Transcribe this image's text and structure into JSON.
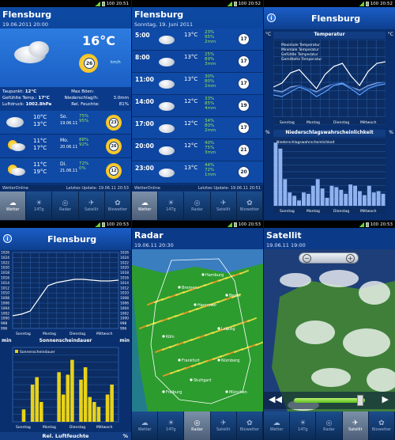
{
  "status_times": [
    "20:51",
    "20:52",
    "20:52",
    "20:53",
    "20:53",
    "20:53"
  ],
  "battery": "100",
  "p1": {
    "title": "Flensburg",
    "date": "19.06.2011 20:00",
    "temp": "16°C",
    "wind_speed": "26",
    "wind_unit": "km/h",
    "details": [
      {
        "label": "Taupunkt:",
        "value": "12°C",
        "label2": "Max Böen:",
        "value2": ""
      },
      {
        "label": "Gefühlte Temp.:",
        "value": "17°C",
        "label2": "Niederschlag/h:",
        "value2": "3.0mm"
      },
      {
        "label": "Luftdruck:",
        "value": "1002.8hPa",
        "label2": "Rel. Feuchte:",
        "value2": "81%"
      }
    ],
    "days": [
      {
        "hi": "10°C",
        "lo": "13°C",
        "day": "So.",
        "date": "19.06.11",
        "p1": "75%",
        "p2": "95%",
        "p3": "",
        "wind": "23"
      },
      {
        "hi": "11°C",
        "lo": "17°C",
        "day": "Mo.",
        "date": "20.06.11",
        "p1": "88%",
        "p2": "92%",
        "p3": "",
        "wind": "26"
      },
      {
        "hi": "11°C",
        "lo": "19°C",
        "day": "Di.",
        "date": "21.06.11",
        "p1": "72%",
        "p2": "0%",
        "p3": "",
        "wind": "12"
      }
    ],
    "footer_left": "WetterOnline",
    "footer_right": "Letztes Update: 19.06.11 20:53",
    "tabs": [
      "Wetter",
      "14Tg",
      "Radar",
      "Satellit",
      "Biowetter"
    ]
  },
  "p2": {
    "title": "Flensburg",
    "date": "Sonntag, 19. Juni 2011",
    "hours": [
      {
        "time": "5:00",
        "temp": "13°C",
        "g1": "23%",
        "g2": "95%",
        "g3": "2mm",
        "wind": "17"
      },
      {
        "time": "8:00",
        "temp": "13°C",
        "g1": "25%",
        "g2": "89%",
        "g3": "3mm",
        "wind": "17"
      },
      {
        "time": "11:00",
        "temp": "13°C",
        "g1": "30%",
        "g2": "80%",
        "g3": "2mm",
        "wind": "17"
      },
      {
        "time": "14:00",
        "temp": "12°C",
        "g1": "33%",
        "g2": "85%",
        "g3": "4mm",
        "wind": "19"
      },
      {
        "time": "17:00",
        "temp": "12°C",
        "g1": "34%",
        "g2": "80%",
        "g3": "2mm",
        "wind": "17"
      },
      {
        "time": "20:00",
        "temp": "12°C",
        "g1": "40%",
        "g2": "75%",
        "g3": "3mm",
        "wind": "21"
      },
      {
        "time": "23:00",
        "temp": "13°C",
        "g1": "44%",
        "g2": "72%",
        "g3": "1mm",
        "wind": "20"
      }
    ],
    "footer_left": "WetterOnline",
    "footer_right": "Letztes Update: 19.06.11 20:51",
    "tabs": [
      "Wetter",
      "14Tg",
      "Radar",
      "Satellit",
      "Biowetter"
    ]
  },
  "p3": {
    "title": "Flensburg",
    "chart1_title": "Temperatur",
    "chart1_unit": "°C",
    "chart1_legend": [
      "Maximale Temperatur",
      "Minimale Temperatur",
      "Gefühlte Temperatur",
      "Gemittelte Temperatur"
    ],
    "chart2_title": "Niederschlagswahrscheinlichkeit",
    "chart2_unit": "%",
    "chart2_legend": [
      "Niederschlagswahrscheinlichkeit"
    ],
    "days": [
      "Sonntag",
      "Montag",
      "Dienstag",
      "Mittwoch"
    ],
    "tabs": [
      "Wetter",
      "14Tg",
      "Radar",
      "Satellit",
      "Biowetter"
    ]
  },
  "p4": {
    "title": "Flensburg",
    "yaxis": [
      "1026",
      "1024",
      "1022",
      "1020",
      "1018",
      "1016",
      "1014",
      "1012",
      "1010",
      "1008",
      "1006",
      "1004",
      "1002",
      "1000",
      "998",
      "996"
    ],
    "days": [
      "Sonntag",
      "Montag",
      "Dienstag",
      "Mittwoch"
    ],
    "chart2_title": "Sonnenscheindauer",
    "chart2_left_unit": "min",
    "chart2_right_unit": "min",
    "chart2_legend": "Sonnenscheindauer",
    "bottom_title": "Rel. Luftfeuchte",
    "bottom_unit": "%"
  },
  "p5": {
    "title": "Radar",
    "date": "19.06.11 20:30",
    "cities": [
      "Hamburg",
      "Bremen",
      "Berlin",
      "Hannover",
      "Leipzig",
      "Köln",
      "Frankfurt",
      "Nürnberg",
      "Freiburg",
      "München",
      "Stuttgart"
    ],
    "tabs": [
      "Wetter",
      "14Tg",
      "Radar",
      "Satellit",
      "Biowetter"
    ]
  },
  "p6": {
    "title": "Satellit",
    "date": "19.06.11 19:00",
    "tabs": [
      "Wetter",
      "14Tg",
      "Radar",
      "Satellit",
      "Biowetter"
    ]
  },
  "colors": {
    "accent": "#0d4aa5",
    "rain": "#98e35a",
    "bars": "#e8d21a",
    "barblue": "#8fb3f0"
  }
}
